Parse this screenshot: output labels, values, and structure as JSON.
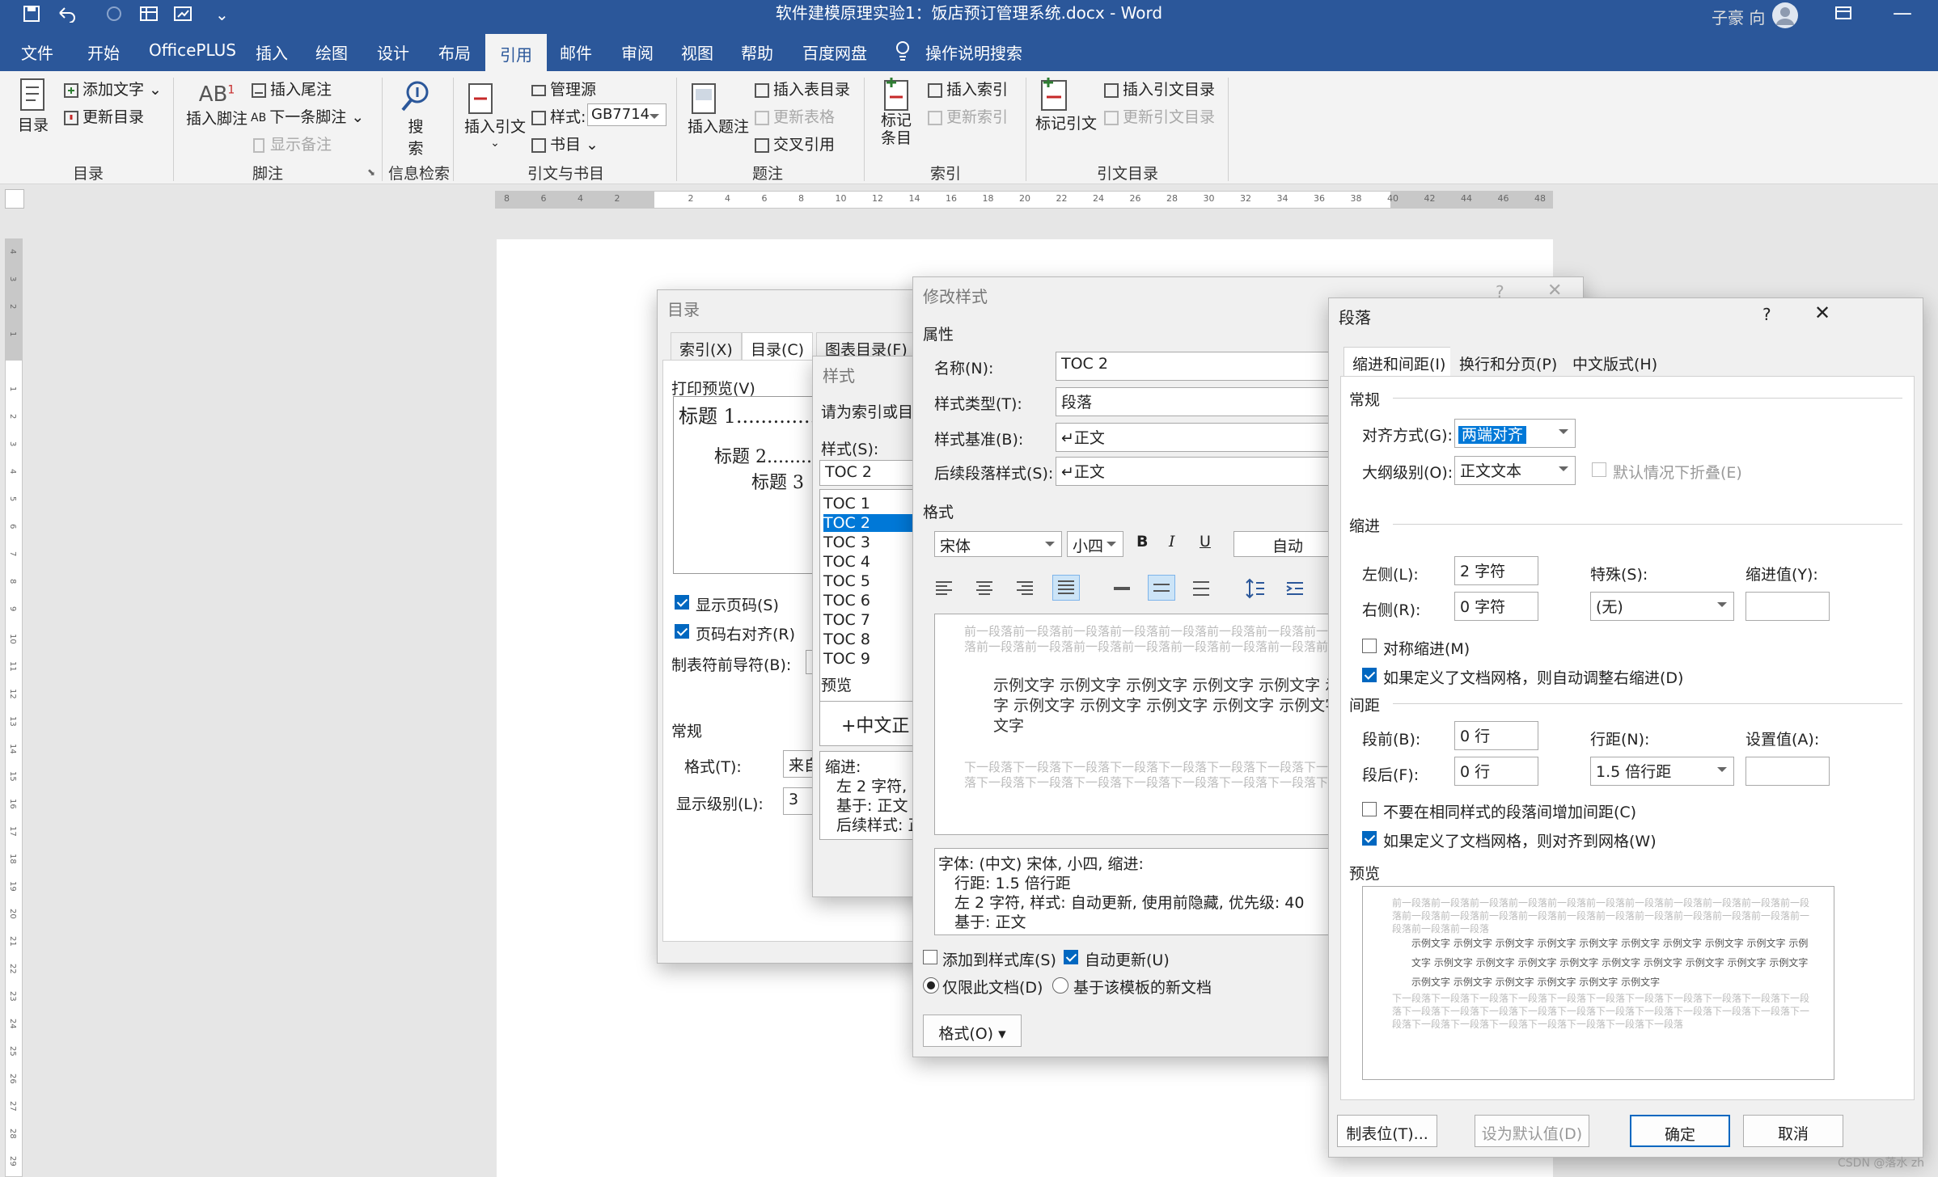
{
  "window": {
    "title": "软件建模原理实验1：饭店预订管理系统.docx - Word",
    "user": "子豪 向"
  },
  "menu": [
    "文件",
    "开始",
    "OfficePLUS",
    "插入",
    "绘图",
    "设计",
    "布局",
    "引用",
    "邮件",
    "审阅",
    "视图",
    "帮助",
    "百度网盘"
  ],
  "menu_active": "引用",
  "tell_me": "操作说明搜索",
  "ribbon": {
    "toc": "目录",
    "add_text": "添加文字",
    "update_toc": "更新目录",
    "group_toc": "目录",
    "insert_footnote": "插入脚注",
    "insert_endnote": "插入尾注",
    "next_footnote": "下一条脚注",
    "show_notes": "显示备注",
    "group_footnotes": "脚注",
    "search": "搜索",
    "group_research": "信息检索",
    "insert_citation": "插入引文",
    "manage_sources": "管理源",
    "style_label": "样式:",
    "style_value": "GB7714",
    "bibliography": "书目",
    "group_citations": "引文与书目",
    "insert_caption": "插入题注",
    "insert_tof": "插入表目录",
    "update_table": "更新表格",
    "cross_ref": "交叉引用",
    "group_captions": "题注",
    "mark_entry": "标记条目",
    "insert_index": "插入索引",
    "update_index": "更新索引",
    "group_index": "索引",
    "mark_citation": "标记引文",
    "insert_toa": "插入引文目录",
    "update_toa": "更新引文目录",
    "group_toa": "引文目录"
  },
  "ruler_marks": [
    "8",
    "6",
    "4",
    "2",
    "",
    "2",
    "4",
    "6",
    "8",
    "10",
    "12",
    "14",
    "16",
    "18",
    "20",
    "22",
    "24",
    "26",
    "28",
    "30",
    "32",
    "34",
    "36",
    "38",
    "40",
    "42",
    "44",
    "46",
    "48"
  ],
  "vruler_marks": [
    "4",
    "3",
    "2",
    "1",
    "",
    "1",
    "2",
    "3",
    "4",
    "5",
    "6",
    "7",
    "8",
    "9",
    "10",
    "11",
    "12",
    "13",
    "14",
    "15",
    "16",
    "17",
    "18",
    "19",
    "20",
    "21",
    "22",
    "23",
    "24",
    "25",
    "26",
    "27",
    "28",
    "29"
  ],
  "dlg_toc": {
    "title": "目录",
    "tabs": [
      "索引(X)",
      "目录(C)",
      "图表目录(F)"
    ],
    "print_preview": "打印预览(V)",
    "preview_lines": [
      "标题 1.............",
      "标题 2........",
      "标题 3"
    ],
    "show_page_numbers": "显示页码(S)",
    "right_align": "页码右对齐(R)",
    "leader": "制表符前导符(B):",
    "general": "常规",
    "formats_label": "格式(T):",
    "formats_value": "来自",
    "levels_label": "显示级别(L):",
    "levels_value": "3"
  },
  "dlg_style": {
    "title": "样式",
    "prompt": "请为索引或目录",
    "styles_label": "样式(S):",
    "styles_value": "TOC 2",
    "list": [
      "TOC 1",
      "TOC 2",
      "TOC 3",
      "TOC 4",
      "TOC 5",
      "TOC 6",
      "TOC 7",
      "TOC 8",
      "TOC 9"
    ],
    "list_selected": "TOC 2",
    "preview": "预览",
    "preview_text": "+中文正",
    "desc_title": "缩进:",
    "desc": [
      "左 2 字符,",
      "基于: 正文",
      "后续样式: 正"
    ]
  },
  "dlg_modify": {
    "title": "修改样式",
    "properties": "属性",
    "name_label": "名称(N):",
    "name_value": "TOC 2",
    "type_label": "样式类型(T):",
    "type_value": "段落",
    "based_label": "样式基准(B):",
    "based_value": "↵正文",
    "follow_label": "后续段落样式(S):",
    "follow_value": "↵正文",
    "format": "格式",
    "font": "宋体",
    "size": "小四",
    "color": "自动",
    "bold": "B",
    "italic": "I",
    "underline": "U",
    "prev_para": "前一段落前一段落前一段落前一段落前一段落前一段落前一段落前一段落前一段落前一段落前一段落前一段落前一段落前一段落前一段落前一段落前一段落前一段落前一段落前一段落前一段落前一段落",
    "sample": "示例文字 示例文字 示例文字 示例文字 示例文字 示例文字 示例文字 示例文字 示例文字 示例文字 示例文字 示例文字 示例文字 示例文字 示例文字 示例文字 示例文字 示例文字",
    "next_para": "下一段落下一段落下一段落下一段落下一段落下一段落下一段落下一段落下一段落下一段落下一段落下一段落下一段落下一段落下一段落下一段落下一段落下一段落下一段落下一段落下一段落下一段落下一段落",
    "desc": [
      "字体: (中文) 宋体, 小四, 缩进:",
      "行距: 1.5 倍行距",
      "左 2 字符, 样式: 自动更新, 使用前隐藏, 优先级: 40",
      "基于: 正文"
    ],
    "add_gallery": "添加到样式库(S)",
    "auto_update": "自动更新(U)",
    "only_doc": "仅限此文档(D)",
    "new_docs": "基于该模板的新文档",
    "format_btn": "格式(O)"
  },
  "dlg_para": {
    "title": "段落",
    "help": "?",
    "tabs": [
      "缩进和间距(I)",
      "换行和分页(P)",
      "中文版式(H)"
    ],
    "general": "常规",
    "align_label": "对齐方式(G):",
    "align_value": "两端对齐",
    "outline_label": "大纲级别(O):",
    "outline_value": "正文文本",
    "collapse": "默认情况下折叠(E)",
    "indent": "缩进",
    "left_label": "左侧(L):",
    "left_value": "2 字符",
    "right_label": "右侧(R):",
    "right_value": "0 字符",
    "special_label": "特殊(S):",
    "special_value": "(无)",
    "by_label": "缩进值(Y):",
    "mirror": "对称缩进(M)",
    "auto_right": "如果定义了文档网格，则自动调整右缩进(D)",
    "spacing": "间距",
    "before_label": "段前(B):",
    "before_value": "0 行",
    "after_label": "段后(F):",
    "after_value": "0 行",
    "line_label": "行距(N):",
    "line_value": "1.5 倍行距",
    "at_label": "设置值(A):",
    "no_space": "不要在相同样式的段落间增加间距(C)",
    "snap_grid": "如果定义了文档网格，则对齐到网格(W)",
    "preview": "预览",
    "prev_para": "前一段落前一段落前一段落前一段落前一段落前一段落前一段落前一段落前一段落前一段落前一段落前一段落前一段落前一段落前一段落前一段落前一段落前一段落前一段落前一段落前一段落前一段落前一段落前一段落",
    "sample": "示例文字 示例文字 示例文字 示例文字 示例文字 示例文字 示例文字 示例文字 示例文字 示例文字 示例文字 示例文字 示例文字 示例文字 示例文字 示例文字 示例文字 示例文字 示例文字 示例文字 示例文字 示例文字 示例文字 示例文字 示例文字",
    "next_para": "下一段落下一段落下一段落下一段落下一段落下一段落下一段落下一段落下一段落下一段落下一段落下一段落下一段落下一段落下一段落下一段落下一段落下一段落下一段落下一段落下一段落下一段落下一段落下一段落下一段落下一段落下一段落下一段落下一段落",
    "tabs_btn": "制表位(T)...",
    "default_btn": "设为默认值(D)",
    "ok": "确定",
    "cancel": "取消"
  },
  "watermark": "CSDN @落水 zh",
  "colors": {
    "brand": "#2b579a",
    "accent": "#0067c0",
    "selection": "#0078d7"
  }
}
